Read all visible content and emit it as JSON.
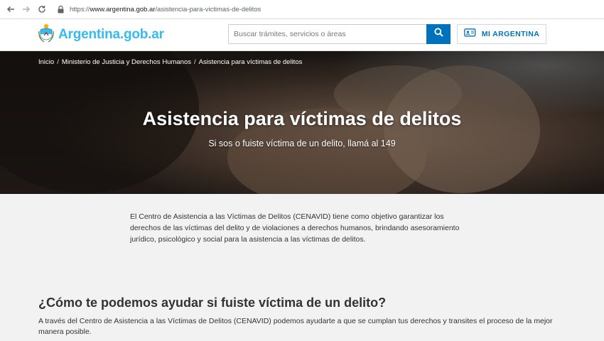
{
  "browser": {
    "url_scheme": "https://",
    "url_host": "www.argentina.gob.ar",
    "url_path": "/asistencia-para-victimas-de-delitos"
  },
  "header": {
    "logo_text": "Argentina.gob.ar",
    "search_placeholder": "Buscar trámites, servicios o áreas",
    "mi_argentina_label": "MI ARGENTINA"
  },
  "breadcrumb": {
    "items": [
      "Inicio",
      "Ministerio de Justicia y Derechos Humanos",
      "Asistencia para víctimas de delitos"
    ],
    "separator": "/"
  },
  "hero": {
    "title": "Asistencia para víctimas de delitos",
    "subtitle": "Si sos o fuiste víctima de un delito, llamá al 149"
  },
  "content": {
    "intro_lines": [
      "El Centro de Asistencia a las Víctimas de Delitos (CENAVID) tiene como objetivo garantizar los",
      "derechos de las víctimas del delito y de violaciones a derechos humanos, brindando asesoramiento",
      "jurídico, psicológico y social para la asistencia a las víctimas de delitos."
    ],
    "section_title": "¿Cómo te podemos ayudar si fuiste víctima de un delito?",
    "section_lines": [
      "A través del Centro de Asistencia a las Víctimas de Delitos (CENAVID) podemos ayudarte a que se cumplan tus derechos y transites el proceso de la mejor",
      "manera posible."
    ]
  },
  "colors": {
    "brand_blue": "#0072bb",
    "logo_blue": "#37bbed",
    "page_bg": "#f2f2f2"
  },
  "icons": [
    "back-arrow-icon",
    "forward-arrow-icon",
    "lock-icon",
    "coat-of-arms-icon",
    "search-icon",
    "id-card-icon"
  ]
}
